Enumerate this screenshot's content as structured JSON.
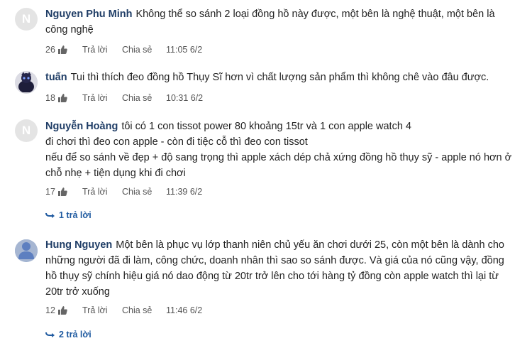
{
  "comments": [
    {
      "avatar_letter": "N",
      "name": "Nguyen Phu Minh",
      "text_lines": [
        "Không thể so sánh 2 loại đồng hồ này được, một bên là nghệ thuật, một bên là",
        "công nghệ"
      ],
      "likes": "26",
      "reply_label": "Trả lời",
      "share_label": "Chia sẻ",
      "time": "11:05 6/2"
    },
    {
      "avatar_icon": "user-photo-icon",
      "name": "tuấn",
      "text_lines": [
        "Tui thì thích đeo đồng hồ Thụy Sĩ hơn vì chất lượng sản phẩm thì không chê vào đâu được."
      ],
      "likes": "18",
      "reply_label": "Trả lời",
      "share_label": "Chia sẻ",
      "time": "10:31 6/2"
    },
    {
      "avatar_letter": "N",
      "name": "Nguyễn Hoàng",
      "text_lines": [
        "tôi có 1 con tissot power 80 khoảng 15tr và 1 con apple watch 4",
        "đi chơi thì đeo con apple - còn đi tiệc cỗ thì đeo con tissot",
        "nếu để so sánh về đẹp + độ sang trọng thì apple xách dép chả xứng đồng hồ thụy sỹ - apple nó hơn ở",
        "chỗ nhẹ + tiện dụng khi đi chơi"
      ],
      "likes": "17",
      "reply_label": "Trả lời",
      "share_label": "Chia sẻ",
      "time": "11:39 6/2",
      "replies": "1 trả lời"
    },
    {
      "avatar_icon": "default-user-icon",
      "name": "Hung Nguyen",
      "text_lines": [
        "Một bên là phục vụ lớp thanh niên chủ yếu ăn chơi dưới 25, còn một bên là dành cho",
        "những người đã đi làm, công chức, doanh nhân thì sao so sánh được. Và giá của nó cũng vậy, đồng",
        "hồ thụy sỹ chính hiệu giá nó dao động từ 20tr trở lên cho tới hàng tỷ đồng còn apple watch thì lại từ",
        "20tr trở xuống"
      ],
      "likes": "12",
      "reply_label": "Trả lời",
      "share_label": "Chia sẻ",
      "time": "11:46 6/2",
      "replies": "2 trả lời"
    }
  ],
  "colors": {
    "name": "#1f3d66",
    "link": "#1f5aa0",
    "meta": "#555555"
  }
}
